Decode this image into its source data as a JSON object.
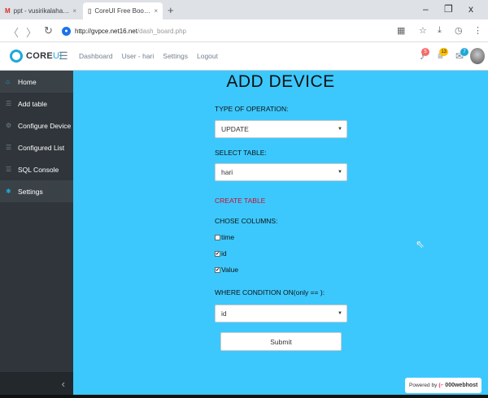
{
  "browser": {
    "tabs": [
      {
        "favicon": "M",
        "title": "ppt - vusirikalaharikiran@",
        "close": "×"
      },
      {
        "favicon": "▯",
        "title": "CoreUI Free Bootstrap Ad",
        "close": "×"
      }
    ],
    "new_tab": "+",
    "window_controls": {
      "minimize": "–",
      "restore": "❐",
      "close": "x"
    },
    "url_host": "http://gvpce.net16.net",
    "url_path": "/dash_board.php"
  },
  "header": {
    "brand_prefix": "CORE",
    "brand_suffix": "UI",
    "nav": [
      "Dashboard",
      "User - hari",
      "Settings",
      "Logout"
    ],
    "badges": {
      "notifications": "5",
      "tasks": "13",
      "messages": "7"
    },
    "colors": {
      "danger": "#f86c6b",
      "warning": "#ffc107",
      "info": "#20a8d8"
    }
  },
  "sidebar": {
    "items": [
      {
        "label": "Home",
        "icon": "home-icon"
      },
      {
        "label": "Add table",
        "icon": "list-icon"
      },
      {
        "label": "Configure Device",
        "icon": "settings-icon"
      },
      {
        "label": "Configured List",
        "icon": "list-icon"
      },
      {
        "label": "SQL Console",
        "icon": "list-icon"
      },
      {
        "label": "Settings",
        "icon": "gear-icon"
      }
    ],
    "toggle": "‹"
  },
  "main": {
    "title": "ADD DEVICE",
    "operation_label": "TYPE OF OPERATION:",
    "operation_value": "UPDATE",
    "table_label": "SELECT TABLE:",
    "table_value": "hari",
    "create_table": "CREATE TABLE",
    "columns_label": "CHOSE COLUMNS:",
    "columns": [
      {
        "name": "time",
        "checked": false
      },
      {
        "name": "id",
        "checked": true
      },
      {
        "name": "Value",
        "checked": true
      }
    ],
    "where_label": "WHERE CONDITION ON(only == ):",
    "where_value": "id",
    "submit": "Submit",
    "powered_by": "Powered by",
    "host_name": "000webhost",
    "background": "#3cc8fd"
  }
}
